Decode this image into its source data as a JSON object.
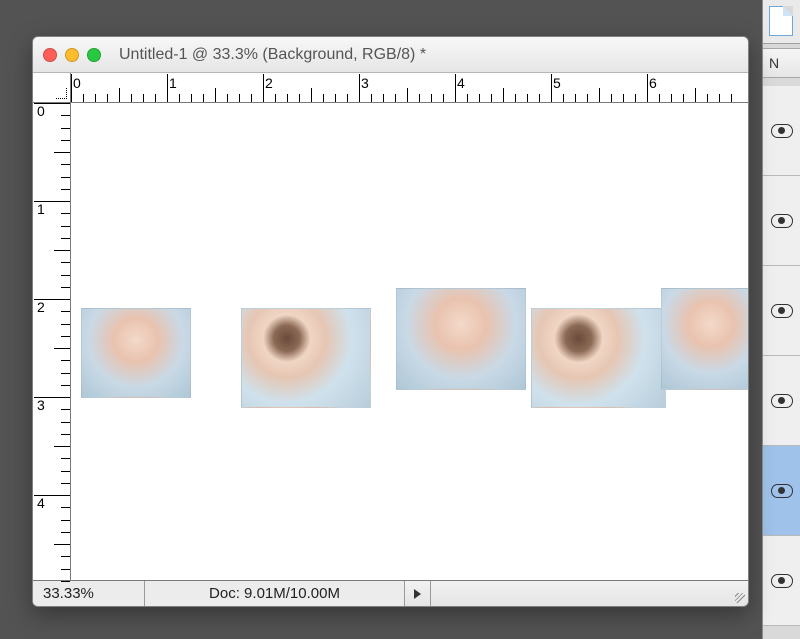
{
  "window": {
    "title": "Untitled-1 @ 33.3% (Background, RGB/8) *"
  },
  "rulers": {
    "h_labels": [
      "0",
      "1",
      "2",
      "3",
      "4",
      "5",
      "6"
    ],
    "v_labels": [
      "0",
      "1",
      "2",
      "3",
      "4"
    ]
  },
  "status": {
    "zoom": "33.33%",
    "doc_info": "Doc: 9.01M/10.00M"
  },
  "panel": {
    "tab_label": "N"
  },
  "layers": {
    "count": 6,
    "selected_index": 4
  }
}
